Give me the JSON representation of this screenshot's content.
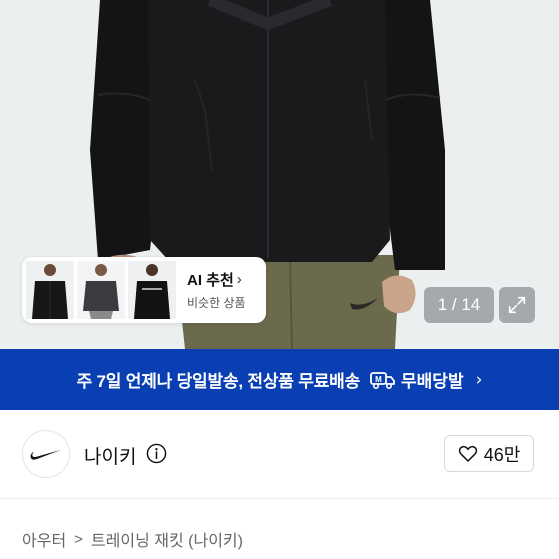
{
  "hero": {
    "ai_card": {
      "title": "AI 추천",
      "subtitle": "비슷한 상품",
      "chevron": "›"
    },
    "counter": "1 / 14",
    "expand_icon": "expand-icon"
  },
  "banner": {
    "text": "주 7일 언제나 당일발송, 전상품 무료배송",
    "badge": "무배당발",
    "chevron": "›",
    "background": "#0a3fb3",
    "icon": "delivery-truck-icon"
  },
  "shop": {
    "name": "나이키",
    "likes": "46만",
    "logo_icon": "nike-swoosh-icon"
  },
  "breadcrumb": {
    "items": [
      "아우터",
      "트레이닝 재킷 (나이키)"
    ],
    "separator": ">"
  }
}
